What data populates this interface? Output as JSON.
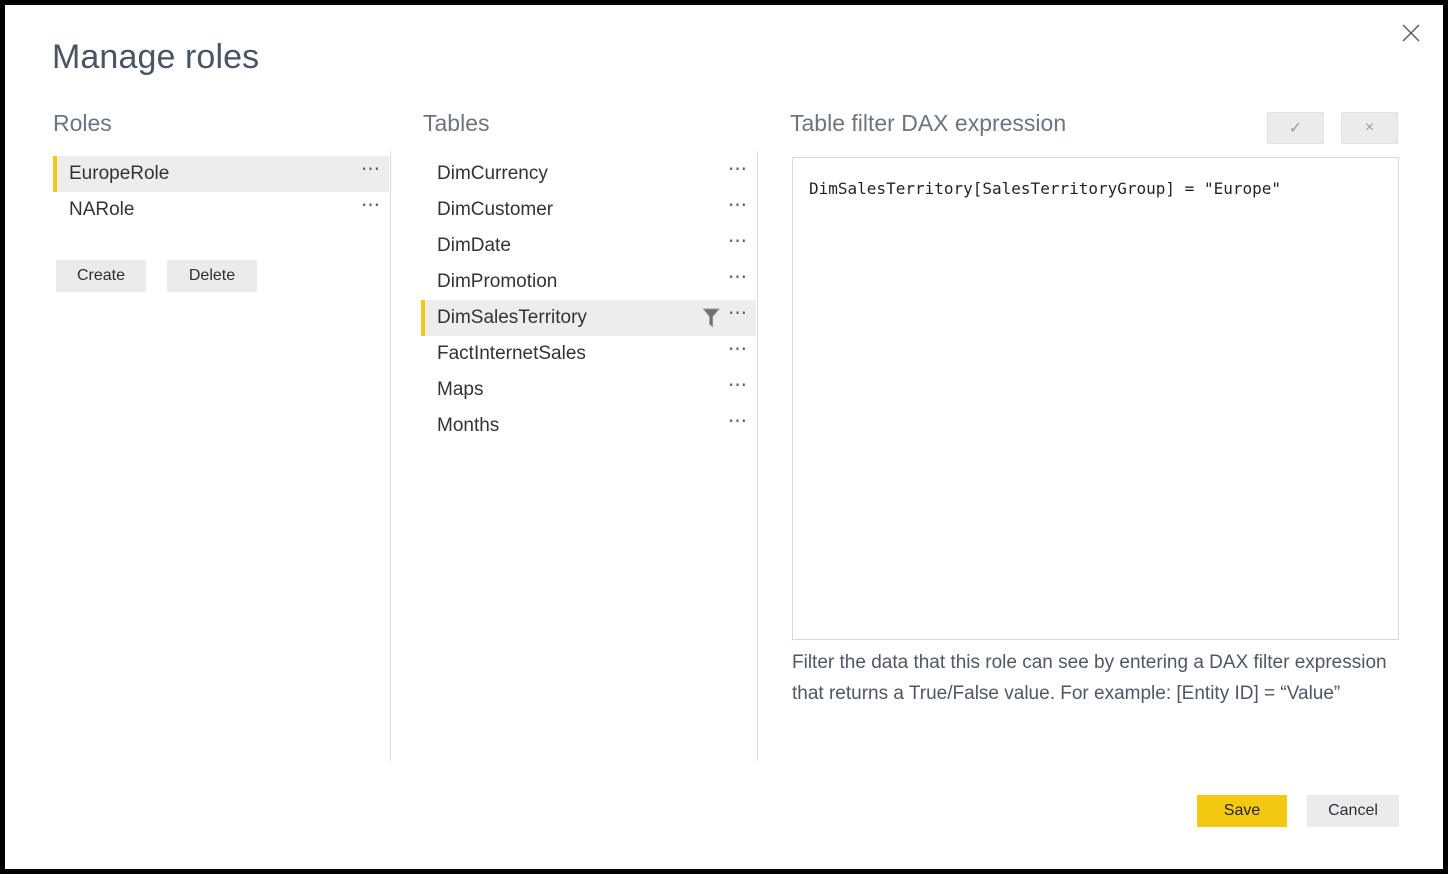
{
  "dialog": {
    "title": "Manage roles",
    "close_icon": "close-icon"
  },
  "roles_panel": {
    "heading": "Roles",
    "items": [
      {
        "label": "EuropeRole",
        "selected": true,
        "menu_icon": "ellipsis-icon"
      },
      {
        "label": "NARole",
        "selected": false,
        "menu_icon": "ellipsis-icon"
      }
    ],
    "create_label": "Create",
    "delete_label": "Delete"
  },
  "tables_panel": {
    "heading": "Tables",
    "items": [
      {
        "label": "DimCurrency",
        "selected": false,
        "has_filter": false,
        "menu_icon": "ellipsis-icon"
      },
      {
        "label": "DimCustomer",
        "selected": false,
        "has_filter": false,
        "menu_icon": "ellipsis-icon"
      },
      {
        "label": "DimDate",
        "selected": false,
        "has_filter": false,
        "menu_icon": "ellipsis-icon"
      },
      {
        "label": "DimPromotion",
        "selected": false,
        "has_filter": false,
        "menu_icon": "ellipsis-icon"
      },
      {
        "label": "DimSalesTerritory",
        "selected": true,
        "has_filter": true,
        "filter_icon": "funnel-filter-icon",
        "menu_icon": "ellipsis-icon"
      },
      {
        "label": "FactInternetSales",
        "selected": false,
        "has_filter": false,
        "menu_icon": "ellipsis-icon"
      },
      {
        "label": "Maps",
        "selected": false,
        "has_filter": false,
        "menu_icon": "ellipsis-icon"
      },
      {
        "label": "Months",
        "selected": false,
        "has_filter": false,
        "menu_icon": "ellipsis-icon"
      }
    ]
  },
  "dax_panel": {
    "heading": "Table filter DAX expression",
    "accept_label": "✓",
    "reject_label": "×",
    "accept_icon": "checkmark-icon",
    "reject_icon": "cross-icon",
    "expression": "DimSalesTerritory[SalesTerritoryGroup] = \"Europe\"",
    "placeholder": "",
    "helper_text": "Filter the data that this role can see by entering a DAX filter expression that returns a True/False value. For example: [Entity ID] = “Value”"
  },
  "footer": {
    "save_label": "Save",
    "cancel_label": "Cancel"
  },
  "colors": {
    "accent_yellow": "#F2C811",
    "selected_row_bg": "#EDEDED",
    "button_gray": "#EBEBEB",
    "divider": "#DCDCDC",
    "text_dark": "#333333",
    "text_muted": "#6B7580"
  }
}
